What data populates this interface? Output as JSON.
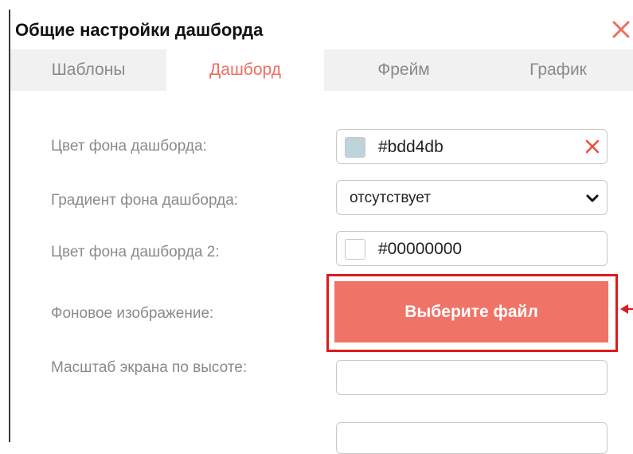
{
  "dialog": {
    "title": "Общие настройки дашборда",
    "close_icon": "close-x-icon"
  },
  "tabs": [
    {
      "label": "Шаблоны",
      "active": false
    },
    {
      "label": "Дашборд",
      "active": true
    },
    {
      "label": "Фрейм",
      "active": false
    },
    {
      "label": "График",
      "active": false
    }
  ],
  "settings": {
    "bg_color": {
      "label": "Цвет фона дашборда:",
      "value": "#bdd4db",
      "swatch": "#bdd4db"
    },
    "gradient": {
      "label": "Градиент фона дашборда:",
      "value": "отсутствует"
    },
    "bg_color2": {
      "label": "Цвет фона дашборда 2:",
      "value": "#00000000",
      "swatch": "#ffffff"
    },
    "bg_image": {
      "label": "Фоновое изображение:",
      "button_label": "Выберите файл"
    },
    "screen_scale": {
      "label": "Масштаб экрана по высоте:",
      "value": ""
    }
  },
  "colors": {
    "accent": "#ef6e60",
    "button": "#f07367",
    "highlight": "#dd1b1b"
  }
}
